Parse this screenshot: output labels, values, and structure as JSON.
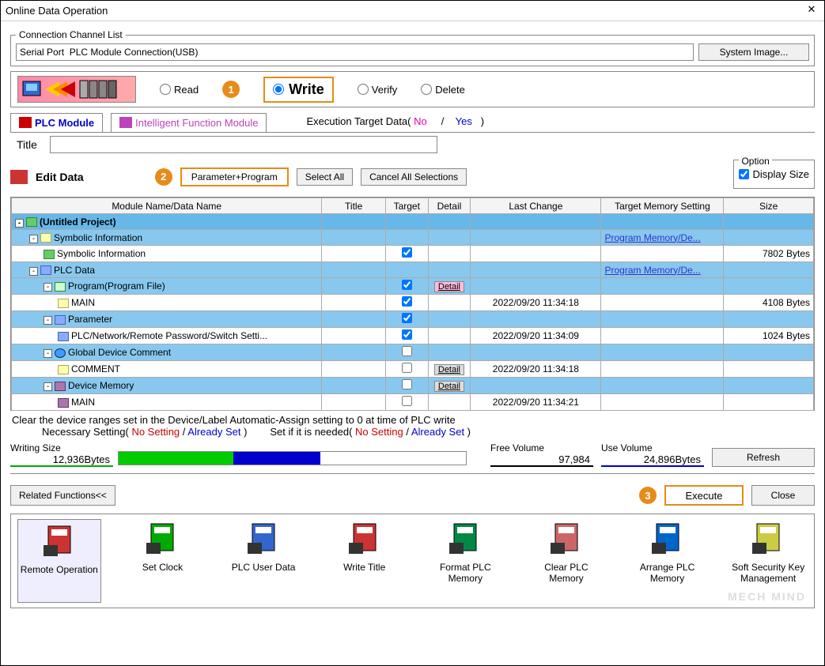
{
  "window": {
    "title": "Online Data Operation"
  },
  "channel": {
    "legend": "Connection Channel List",
    "value": "Serial Port  PLC Module Connection(USB)",
    "system_image_btn": "System Image..."
  },
  "operations": {
    "read": "Read",
    "write": "Write",
    "verify": "Verify",
    "delete": "Delete",
    "selected": "Write"
  },
  "tabs": {
    "plc": "PLC Module",
    "ifm": "Intelligent Function Module",
    "exec_label": "Execution Target Data(",
    "no": "No",
    "sep": "/",
    "yes": "Yes",
    "close_paren": ")"
  },
  "title_section": {
    "label": "Title",
    "value": ""
  },
  "edit": {
    "label": "Edit Data",
    "param_btn": "Parameter+Program",
    "select_all": "Select All",
    "cancel_all": "Cancel All Selections",
    "option_legend": "Option",
    "display_size": "Display Size",
    "display_size_checked": true
  },
  "grid": {
    "headers": {
      "name": "Module Name/Data Name",
      "title": "Title",
      "target": "Target",
      "detail": "Detail",
      "change": "Last Change",
      "mem": "Target Memory Setting",
      "size": "Size"
    },
    "rows": [
      {
        "indent": 0,
        "box": "-",
        "icon": "chip",
        "name": "(Untitled Project)",
        "sel": "hdr"
      },
      {
        "indent": 1,
        "box": "-",
        "icon": "doc",
        "name": "Symbolic Information",
        "sel": "row",
        "mem": "Program Memory/De..."
      },
      {
        "indent": 2,
        "box": "",
        "icon": "chip",
        "name": "Symbolic Information",
        "sel": "",
        "target": true,
        "size": "7802 Bytes"
      },
      {
        "indent": 1,
        "box": "-",
        "icon": "gear",
        "name": "PLC Data",
        "sel": "row",
        "mem": "Program Memory/De..."
      },
      {
        "indent": 2,
        "box": "-",
        "icon": "prog",
        "name": "Program(Program File)",
        "sel": "row",
        "target": true,
        "detail": "pink"
      },
      {
        "indent": 3,
        "box": "",
        "icon": "doc",
        "name": "MAIN",
        "sel": "",
        "target": true,
        "change": "2022/09/20 11:34:18",
        "size": "4108 Bytes"
      },
      {
        "indent": 2,
        "box": "-",
        "icon": "gear",
        "name": "Parameter",
        "sel": "row",
        "target": true
      },
      {
        "indent": 3,
        "box": "",
        "icon": "gear",
        "name": "PLC/Network/Remote Password/Switch Setti...",
        "sel": "",
        "target": true,
        "change": "2022/09/20 11:34:09",
        "size": "1024 Bytes"
      },
      {
        "indent": 2,
        "box": "-",
        "icon": "globe",
        "name": "Global Device Comment",
        "sel": "row",
        "target": false
      },
      {
        "indent": 3,
        "box": "",
        "icon": "doc",
        "name": "COMMENT",
        "sel": "",
        "target": false,
        "detail": "gray",
        "change": "2022/09/20 11:34:18"
      },
      {
        "indent": 2,
        "box": "-",
        "icon": "mem",
        "name": "Device Memory",
        "sel": "row",
        "target": false,
        "detail": "gray"
      },
      {
        "indent": 3,
        "box": "",
        "icon": "mem",
        "name": "MAIN",
        "sel": "",
        "target": false,
        "change": "2022/09/20 11:34:21"
      }
    ]
  },
  "notes": {
    "clear": "Clear the device ranges set in the Device/Label Automatic-Assign setting to 0 at time of PLC write",
    "necessary": "Necessary Setting(",
    "no_setting": "No Setting",
    "slash": " /   ",
    "already_set": "Already Set",
    "close": " )",
    "setif": "Set if it is needed("
  },
  "volume": {
    "writing_label": "Writing Size",
    "writing_value": "12,936Bytes",
    "free_label": "Free Volume",
    "free_value": "97,984",
    "use_label": "Use Volume",
    "use_value": "24,896Bytes",
    "refresh": "Refresh"
  },
  "bottom": {
    "related": "Related Functions<<",
    "execute": "Execute",
    "close": "Close"
  },
  "functions": [
    {
      "label": "Remote Operation",
      "color": "#c33"
    },
    {
      "label": "Set Clock",
      "color": "#0a0"
    },
    {
      "label": "PLC User Data",
      "color": "#36c"
    },
    {
      "label": "Write Title",
      "color": "#c33"
    },
    {
      "label": "Format PLC Memory",
      "color": "#084"
    },
    {
      "label": "Clear PLC Memory",
      "color": "#c66"
    },
    {
      "label": "Arrange PLC Memory",
      "color": "#06c"
    },
    {
      "label": "Soft Security Key Management",
      "color": "#cc4"
    }
  ],
  "badges": {
    "b1": "1",
    "b2": "2",
    "b3": "3"
  },
  "watermark": "MECH MIND"
}
